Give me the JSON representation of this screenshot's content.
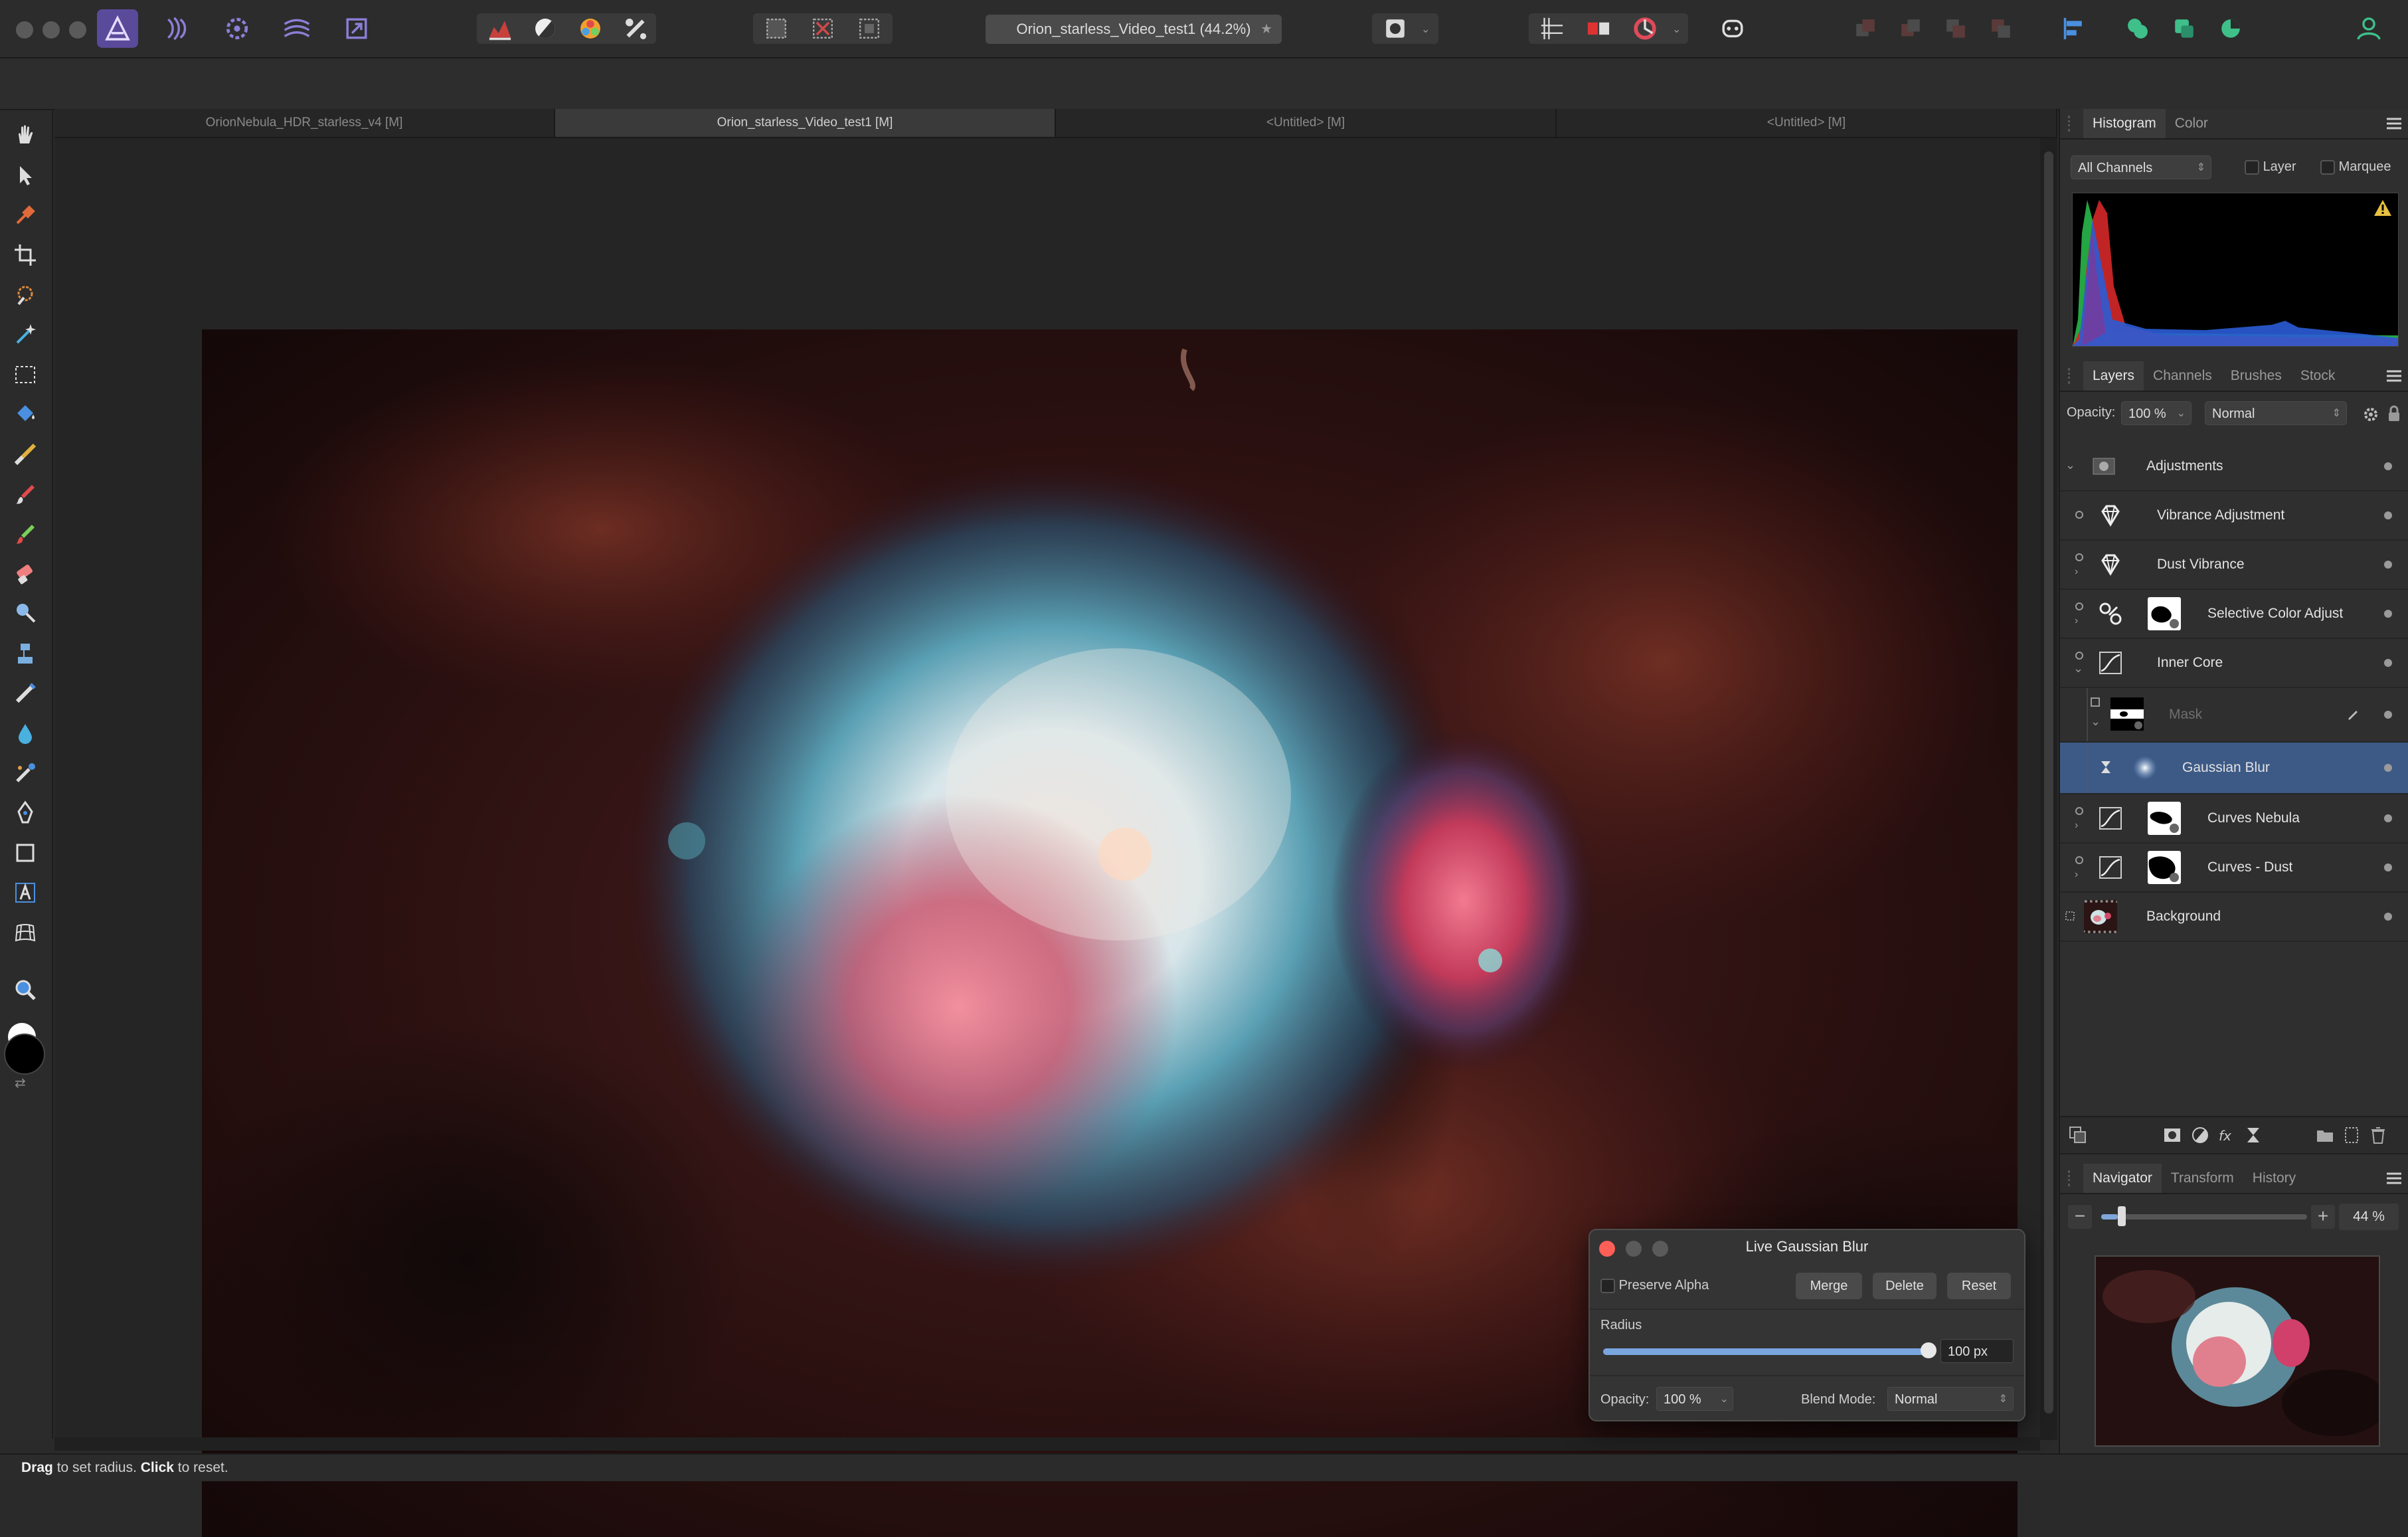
{
  "app": {
    "document_title": "Orion_starless_Video_test1 (44.2%)",
    "status_hint": {
      "bold1": "Drag",
      "text1": " to set radius. ",
      "bold2": "Click",
      "text2": " to reset."
    }
  },
  "document_tabs": [
    "OrionNebula_HDR_starless_v4 [M]",
    "Orion_starless_Video_test1 [M]",
    "<Untitled> [M]",
    "<Untitled> [M]"
  ],
  "histogram_panel": {
    "tabs": [
      "Histogram",
      "Color"
    ],
    "channel_select": "All Channels",
    "layer_label": "Layer",
    "marquee_label": "Marquee",
    "warning_icon": "warning-icon"
  },
  "layers_panel": {
    "tabs": [
      "Layers",
      "Channels",
      "Brushes",
      "Stock"
    ],
    "opacity_label": "Opacity:",
    "opacity_value": "100 %",
    "blend_mode": "Normal",
    "layers": [
      {
        "name": "Adjustments",
        "kind": "group"
      },
      {
        "name": "Vibrance Adjustment",
        "kind": "vibrance"
      },
      {
        "name": "Dust Vibrance",
        "kind": "vibrance"
      },
      {
        "name": "Selective Color Adjust",
        "kind": "selective"
      },
      {
        "name": "Inner Core",
        "kind": "curves"
      },
      {
        "name": "Mask",
        "kind": "mask"
      },
      {
        "name": "Gaussian Blur",
        "kind": "filter"
      },
      {
        "name": "Curves Nebula",
        "kind": "curves"
      },
      {
        "name": "Curves - Dust",
        "kind": "curves"
      },
      {
        "name": "Background",
        "kind": "pixel"
      }
    ]
  },
  "navigator_panel": {
    "tabs": [
      "Navigator",
      "Transform",
      "History"
    ],
    "zoom": "44 %",
    "zoom_slider_value": 0.08
  },
  "gaussian_dialog": {
    "title": "Live Gaussian Blur",
    "preserve_alpha_label": "Preserve Alpha",
    "merge": "Merge",
    "delete": "Delete",
    "reset": "Reset",
    "radius_label": "Radius",
    "radius_value": "100 px",
    "radius_fraction": 1.0,
    "opacity_label": "Opacity:",
    "opacity_value": "100 %",
    "blend_label": "Blend Mode:",
    "blend_value": "Normal"
  },
  "colors": {
    "accent_purple": "#5a4a9a",
    "selection_blue": "#3d5a86",
    "close_red": "#ff5f57"
  }
}
